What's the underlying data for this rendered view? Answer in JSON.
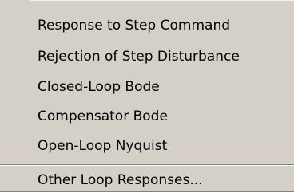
{
  "menu": {
    "items": [
      {
        "label": "Response to Step Command"
      },
      {
        "label": "Rejection of Step Disturbance"
      },
      {
        "label": "Closed-Loop Bode"
      },
      {
        "label": "Compensator Bode"
      },
      {
        "label": "Open-Loop Nyquist"
      }
    ],
    "footer_item": {
      "label": "Other Loop Responses..."
    }
  }
}
